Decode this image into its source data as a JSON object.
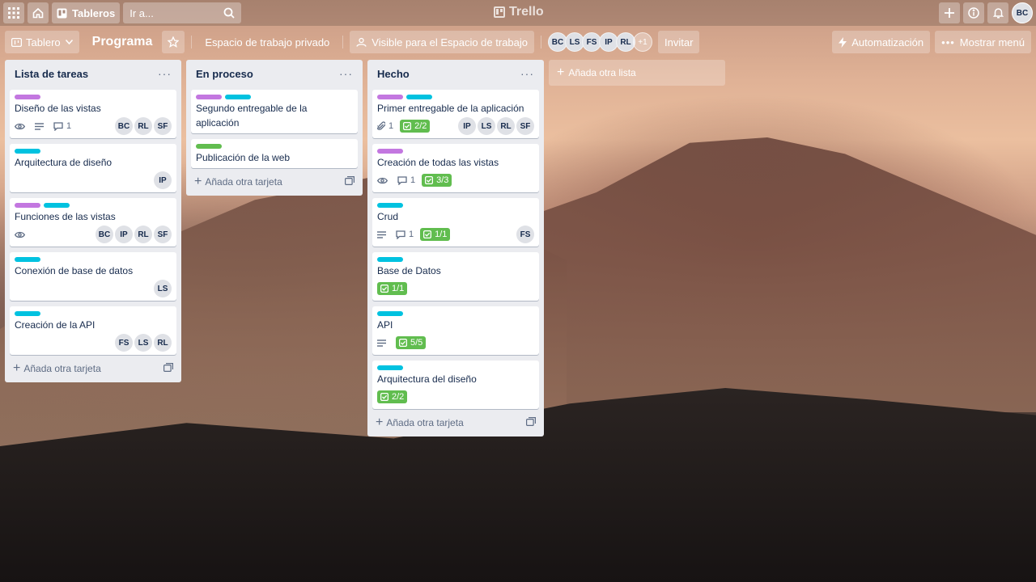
{
  "header": {
    "boards_label": "Tableros",
    "search_placeholder": "Ir a...",
    "logo_text": "Trello",
    "user_avatar": "BC"
  },
  "board": {
    "view_label": "Tablero",
    "title": "Programa",
    "workspace": "Espacio de trabajo privado",
    "visibility": "Visible para el Espacio de trabajo",
    "members": [
      "BC",
      "LS",
      "FS",
      "IP",
      "RL"
    ],
    "members_more": "+1",
    "invite": "Invitar",
    "automation": "Automatización",
    "show_menu": "Mostrar menú"
  },
  "lists": [
    {
      "title": "Lista de tareas",
      "add_card": "Añada otra tarjeta",
      "cards": [
        {
          "labels": [
            "purple"
          ],
          "title": "Diseño de las vistas",
          "watch": true,
          "description": true,
          "comments": "1",
          "members": [
            "BC",
            "RL",
            "SF"
          ]
        },
        {
          "labels": [
            "sky"
          ],
          "title": "Arquitectura de diseño",
          "members": [
            "IP"
          ]
        },
        {
          "labels": [
            "purple",
            "sky"
          ],
          "title": "Funciones de las vistas",
          "watch": true,
          "members": [
            "BC",
            "IP",
            "RL",
            "SF"
          ]
        },
        {
          "labels": [
            "sky"
          ],
          "title": "Conexión de base de datos",
          "members": [
            "LS"
          ]
        },
        {
          "labels": [
            "sky"
          ],
          "title": "Creación de la API",
          "members": [
            "FS",
            "LS",
            "RL"
          ]
        }
      ]
    },
    {
      "title": "En proceso",
      "add_card": "Añada otra tarjeta",
      "cards": [
        {
          "labels": [
            "purple",
            "sky"
          ],
          "title": "Segundo entregable de la aplicación"
        },
        {
          "labels": [
            "green"
          ],
          "title": "Publicación de la web"
        }
      ]
    },
    {
      "title": "Hecho",
      "add_card": "Añada otra tarjeta",
      "cards": [
        {
          "labels": [
            "purple",
            "sky"
          ],
          "title": "Primer entregable de la aplicación",
          "attachments": "1",
          "checklist": "2/2",
          "members": [
            "IP",
            "LS",
            "RL",
            "SF"
          ]
        },
        {
          "labels": [
            "purple"
          ],
          "title": "Creación de todas las vistas",
          "watch": true,
          "comments": "1",
          "checklist": "3/3"
        },
        {
          "labels": [
            "sky"
          ],
          "title": "Crud",
          "description": true,
          "comments": "1",
          "checklist": "1/1",
          "members": [
            "FS"
          ]
        },
        {
          "labels": [
            "sky"
          ],
          "title": "Base de Datos",
          "checklist": "1/1"
        },
        {
          "labels": [
            "sky"
          ],
          "title": "API",
          "description": true,
          "checklist": "5/5"
        },
        {
          "labels": [
            "sky"
          ],
          "title": "Arquitectura del diseño",
          "checklist": "2/2"
        }
      ]
    }
  ],
  "add_list": "Añada otra lista",
  "colors": {
    "label_purple": "#c377e0",
    "label_sky": "#00c2e0",
    "label_green": "#61bd4f",
    "list_bg": "#ebecf0"
  }
}
